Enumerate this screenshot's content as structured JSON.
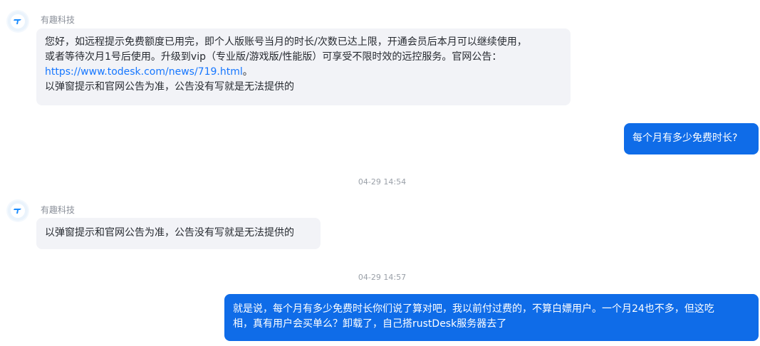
{
  "colors": {
    "incoming_bubble": "#f2f3f7",
    "outgoing_bubble": "#0f6ce8",
    "link": "#1677ff",
    "avatar_accent": "#1a8cff"
  },
  "messages": [
    {
      "type": "incoming",
      "sender": "有趣科技",
      "avatar_icon": "todesk-logo-icon",
      "line1": "您好，如远程提示免费额度已用完，即个人版账号当月的时长/次数已达上限，开通会员后本月可以继续使用，",
      "line2": "或者等待次月1号后使用。升级到vip（专业版/游戏版/性能版）可享受不限时效的远控服务。官网公告：",
      "link_text": "https://www.todesk.com/news/719.html",
      "link_suffix": "。",
      "line4": "以弹窗提示和官网公告为准，公告没有写就是无法提供的"
    },
    {
      "type": "outgoing",
      "text": "每个月有多少免费时长?"
    },
    {
      "type": "timestamp",
      "text": "04-29 14:54"
    },
    {
      "type": "incoming",
      "sender": "有趣科技",
      "avatar_icon": "todesk-logo-icon",
      "text": "以弹窗提示和官网公告为准，公告没有写就是无法提供的"
    },
    {
      "type": "timestamp",
      "text": "04-29 14:57"
    },
    {
      "type": "outgoing",
      "line1": "就是说，每个月有多少免费时长你们说了算对吧，我以前付过费的，不算白嫖用户。一个月24也不多，但这吃",
      "line2": "相，真有用户会买单么？卸载了，自己搭rustDesk服务器去了"
    }
  ]
}
